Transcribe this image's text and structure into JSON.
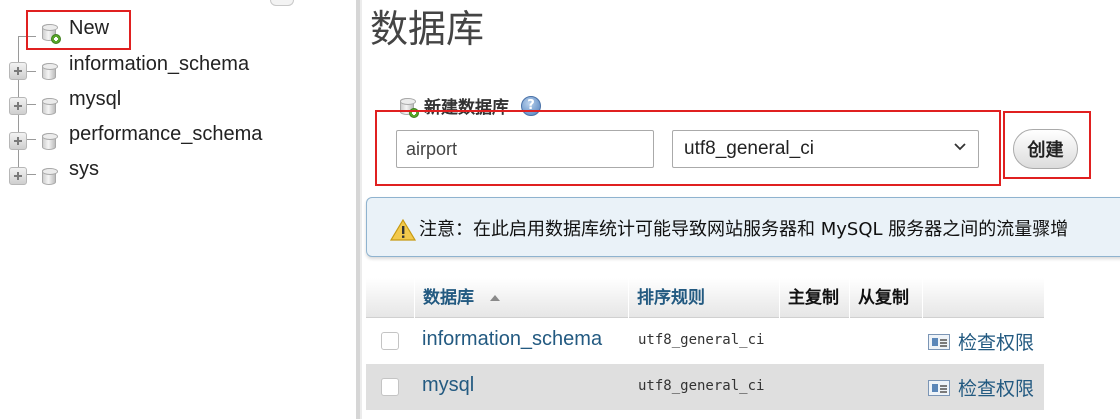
{
  "navigation": {
    "new_label": "New",
    "databases": [
      "information_schema",
      "mysql",
      "performance_schema",
      "sys"
    ]
  },
  "main": {
    "title": "数据库",
    "create": {
      "legend": "新建数据库",
      "help_icon": "help-icon",
      "name_value": "airport",
      "collation_value": "utf8_general_ci",
      "button_label": "创建"
    },
    "notice": {
      "icon": "warning-icon",
      "text": "注意：在此启用数据库统计可能导致网站服务器和 MySQL 服务器之间的流量骤增"
    },
    "table": {
      "headers": {
        "database": "数据库",
        "collation": "排序规则",
        "master_replication": "主复制",
        "slave_replication": "从复制"
      },
      "rows": [
        {
          "name": "information_schema",
          "collation": "utf8_general_ci",
          "action": "检查权限"
        },
        {
          "name": "mysql",
          "collation": "utf8_general_ci",
          "action": "检查权限"
        }
      ]
    }
  },
  "colors": {
    "highlight_box": "#e02020",
    "link": "#235a81",
    "notice_bg": "#eaf2f8"
  }
}
